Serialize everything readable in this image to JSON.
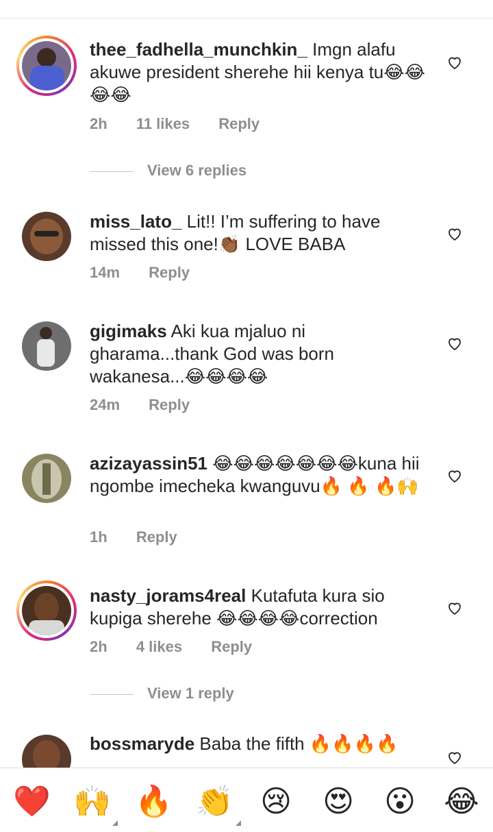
{
  "comments": [
    {
      "username": "thee_fadhella_munchkin_",
      "text": "Imgn alafu akuwe president sherehe hii kenya tu😂😂😂😂",
      "time": "2h",
      "likes": "11 likes",
      "reply": "Reply",
      "view_replies": "View 6 replies",
      "avatar_color": "#7a6a8a"
    },
    {
      "username": "miss_lato_",
      "text": "Lit!! I’m suffering to have missed this one!👏🏾 LOVE BABA",
      "time": "14m",
      "reply": "Reply",
      "avatar_color": "#5a3a2a"
    },
    {
      "username": "gigimaks",
      "text": "Aki kua mjaluo ni gharama...thank God was born wakanesa...😂😂😂😂",
      "time": "24m",
      "reply": "Reply",
      "avatar_color": "#6e6e6e"
    },
    {
      "username": "azizayassin51",
      "text": "😂😂😂😂😂😂😂kuna hii ngombe imecheka kwanguvu🔥 🔥 🔥🙌",
      "time": "1h",
      "reply": "Reply",
      "avatar_color": "#8a8560"
    },
    {
      "username": "nasty_jorams4real",
      "text": "Kutafuta kura sio kupiga sherehe 😂😂😂😂correction",
      "time": "2h",
      "likes": "4 likes",
      "reply": "Reply",
      "view_replies": "View 1 reply",
      "avatar_color": "#4a3020"
    },
    {
      "username": "bossmaryde",
      "text": "Baba the fifth 🔥🔥🔥🔥",
      "avatar_color": "#5a3a2a"
    }
  ],
  "reactions": [
    "❤️",
    "🙌",
    "🔥",
    "👏",
    "😢",
    "😍",
    "😮",
    "😂"
  ],
  "colors": {
    "heart": "#ed4956",
    "muted": "#8e8e8e",
    "text": "#262626"
  }
}
